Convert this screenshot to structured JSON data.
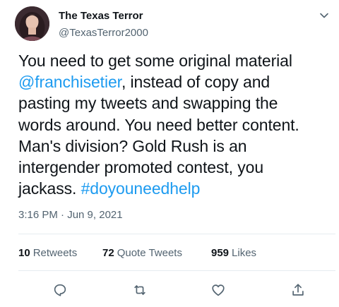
{
  "author": {
    "display_name": "The Texas Terror",
    "handle": "@TexasTerror2000",
    "avatar_icon": "profile-photo"
  },
  "tweet": {
    "lines": [
      [
        {
          "text": "You need to get some original material"
        }
      ],
      [
        {
          "text": "@franchisetier",
          "link": true
        },
        {
          "text": ", instead of copy and"
        }
      ],
      [
        {
          "text": "pasting my tweets and swapping the"
        }
      ],
      [
        {
          "text": "words around. You need better content."
        }
      ],
      [
        {
          "text": "Man's division? Gold Rush is an"
        }
      ],
      [
        {
          "text": "intergender promoted contest, you"
        }
      ],
      [
        {
          "text": "jackass. "
        },
        {
          "text": "#doyouneedhelp",
          "link": true
        }
      ]
    ],
    "timestamp": "3:16 PM · Jun 9, 2021"
  },
  "stats": {
    "retweets_count": "10",
    "retweets_label": "Retweets",
    "quote_count": "72",
    "quote_label": "Quote Tweets",
    "likes_count": "959",
    "likes_label": "Likes"
  },
  "actions": [
    "reply-icon",
    "retweet-icon",
    "like-icon",
    "share-icon"
  ],
  "colors": {
    "link": "#1d9bf0",
    "secondary_text": "#536471",
    "primary_text": "#0f1419"
  }
}
